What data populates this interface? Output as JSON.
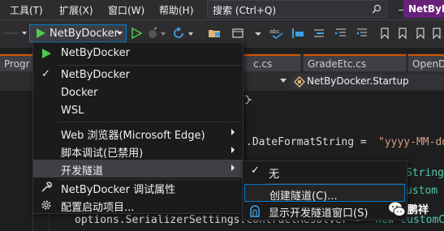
{
  "menubar": {
    "items": [
      "工具(T)",
      "扩展(X)",
      "窗口(W)",
      "帮助(H)"
    ],
    "search_placeholder": "搜索 (Ctrl+Q)",
    "project_name": "NetByD"
  },
  "toolbar": {
    "run_target": "NetByDocker"
  },
  "tabs": [
    "Progr",
    "c.cs",
    "GradeEtc.cs",
    "OpenD"
  ],
  "navbar": {
    "member": "NetByDocker.Startup"
  },
  "editor": {
    "line1_a": ".DateFormatString = ",
    "line1_b": "\"yyyy-MM-dd",
    "line2": "String",
    "line3": "ustom",
    "line4_a": "options.SerializerSettings.ContractResolver = ",
    "line4_b": "new CustomC"
  },
  "dropdown": {
    "items": [
      {
        "label": "NetByDocker",
        "icon": "play-icon"
      },
      {
        "label": "NetByDocker",
        "checked": true
      },
      {
        "label": "Docker"
      },
      {
        "label": "WSL"
      },
      {
        "label": "Web 浏览器(Microsoft Edge)",
        "submenu": true
      },
      {
        "label": "脚本调试(已禁用)",
        "submenu": true
      },
      {
        "label": "开发隧道",
        "submenu": true,
        "highlighted": true
      },
      {
        "label": "NetByDocker 调试属性",
        "icon": "wrench-icon"
      },
      {
        "label": "配置启动项目...",
        "icon": "gear-icon"
      }
    ]
  },
  "submenu": {
    "items": [
      {
        "label": "无",
        "checked": true
      },
      {
        "label": "创建隧道(C)...",
        "selected": true
      },
      {
        "label": "显示开发隧道窗口(S)",
        "icon": "tunnel-icon"
      }
    ]
  },
  "watermark": {
    "text": "鹏祥"
  },
  "colors": {
    "accent": "#007acc",
    "run_green": "#4ec94e",
    "tab_orange": "#d35400",
    "string": "#d69d85",
    "type": "#4ec9b0",
    "keyword": "#569cd6"
  }
}
